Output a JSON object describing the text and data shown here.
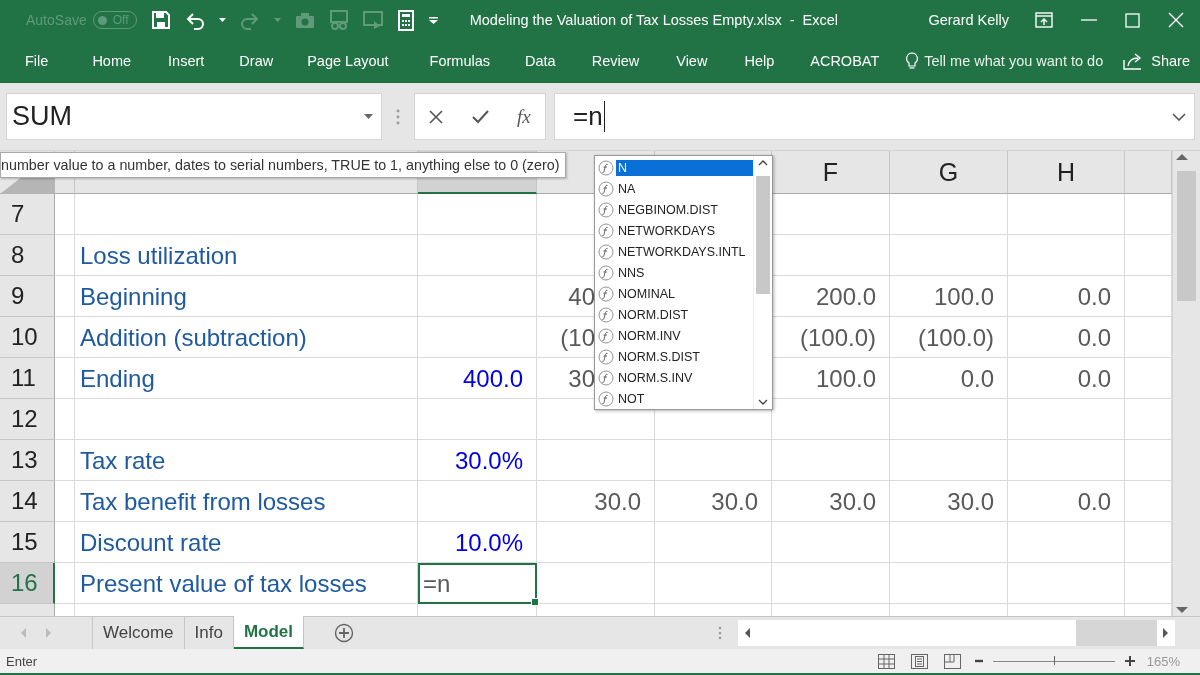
{
  "title_bar": {
    "autosave": {
      "label": "AutoSave",
      "toggle": "Off",
      "on": false
    },
    "title": "Modeling the Valuation of Tax Losses Empty.xlsx  -  Excel",
    "user": "Gerard Kelly"
  },
  "ribbon_tabs": [
    {
      "label": "File",
      "selected": false
    },
    {
      "label": "Home",
      "selected": false
    },
    {
      "label": "Insert",
      "selected": false
    },
    {
      "label": "Draw",
      "selected": false
    },
    {
      "label": "Page Layout",
      "selected": false
    },
    {
      "label": "Formulas",
      "selected": false
    },
    {
      "label": "Data",
      "selected": false
    },
    {
      "label": "Review",
      "selected": false
    },
    {
      "label": "View",
      "selected": false
    },
    {
      "label": "Help",
      "selected": false
    },
    {
      "label": "ACROBAT",
      "selected": false
    }
  ],
  "tell_me": {
    "placeholder": "Tell me what you want to do"
  },
  "share": "Share",
  "formula_bar": {
    "name_box": "SUM",
    "insert_function": "fx",
    "formula": "=n"
  },
  "tooltip": "number value to a number, dates to serial numbers, TRUE to 1, anything else to 0 (zero)",
  "autocomplete": [
    {
      "label": "N",
      "selected": true
    },
    {
      "label": "NA",
      "selected": false
    },
    {
      "label": "NEGBINOM.DIST",
      "selected": false
    },
    {
      "label": "NETWORKDAYS",
      "selected": false
    },
    {
      "label": "NETWORKDAYS.INTL",
      "selected": false
    },
    {
      "label": "NNS",
      "selected": false
    },
    {
      "label": "NOMINAL",
      "selected": false
    },
    {
      "label": "NORM.DIST",
      "selected": false
    },
    {
      "label": "NORM.INV",
      "selected": false
    },
    {
      "label": "NORM.S.DIST",
      "selected": false
    },
    {
      "label": "NORM.S.INV",
      "selected": false
    },
    {
      "label": "NOT",
      "selected": false
    }
  ],
  "columns": [
    {
      "selected": false
    },
    {
      "selected": false
    },
    {
      "selected": true
    },
    {
      "selected": false
    },
    {
      "selected": false
    },
    {
      "label": "F",
      "selected": false
    },
    {
      "label": "G",
      "selected": false
    },
    {
      "label": "H",
      "selected": false
    },
    {
      "selected": false
    }
  ],
  "rows": [
    {
      "number": "7",
      "selected": false,
      "cells": [
        "",
        "",
        "",
        "",
        "",
        "",
        "",
        "",
        ""
      ]
    },
    {
      "number": "8",
      "selected": false,
      "cells": [
        "",
        "Loss utilization",
        "",
        "",
        "",
        "",
        "",
        "",
        ""
      ]
    },
    {
      "number": "9",
      "selected": false,
      "cells": [
        "",
        "Beginning",
        "",
        "40",
        "",
        "200.0",
        "100.0",
        "0.0",
        ""
      ]
    },
    {
      "number": "10",
      "selected": false,
      "cells": [
        "",
        "Addition (subtraction)",
        "",
        "(10",
        "",
        "(100.0)",
        "(100.0)",
        "0.0",
        ""
      ]
    },
    {
      "number": "11",
      "selected": false,
      "cells": [
        "",
        "Ending",
        "400.0",
        "30",
        "",
        "100.0",
        "0.0",
        "0.0",
        ""
      ]
    },
    {
      "number": "12",
      "selected": false,
      "cells": [
        "",
        "",
        "",
        "",
        "",
        "",
        "",
        "",
        ""
      ]
    },
    {
      "number": "13",
      "selected": false,
      "cells": [
        "",
        "Tax rate",
        "30.0%",
        "",
        "",
        "",
        "",
        "",
        ""
      ]
    },
    {
      "number": "14",
      "selected": false,
      "cells": [
        "",
        "Tax benefit from losses",
        "",
        "30.0",
        "30.0",
        "30.0",
        "30.0",
        "0.0",
        ""
      ]
    },
    {
      "number": "15",
      "selected": false,
      "cells": [
        "",
        "Discount rate",
        "10.0%",
        "",
        "",
        "",
        "",
        "",
        ""
      ]
    },
    {
      "number": "16",
      "selected": true,
      "cells": [
        "",
        "Present value of tax losses",
        "=n",
        "",
        "",
        "",
        "",
        "",
        ""
      ]
    }
  ],
  "sheet_tabs": [
    {
      "label": "Welcome",
      "selected": false
    },
    {
      "label": "Info",
      "selected": false
    },
    {
      "label": "Model",
      "selected": true
    }
  ],
  "status_bar": {
    "mode": "Enter",
    "zoom": {
      "level": 0.5,
      "reading": "165%"
    }
  }
}
